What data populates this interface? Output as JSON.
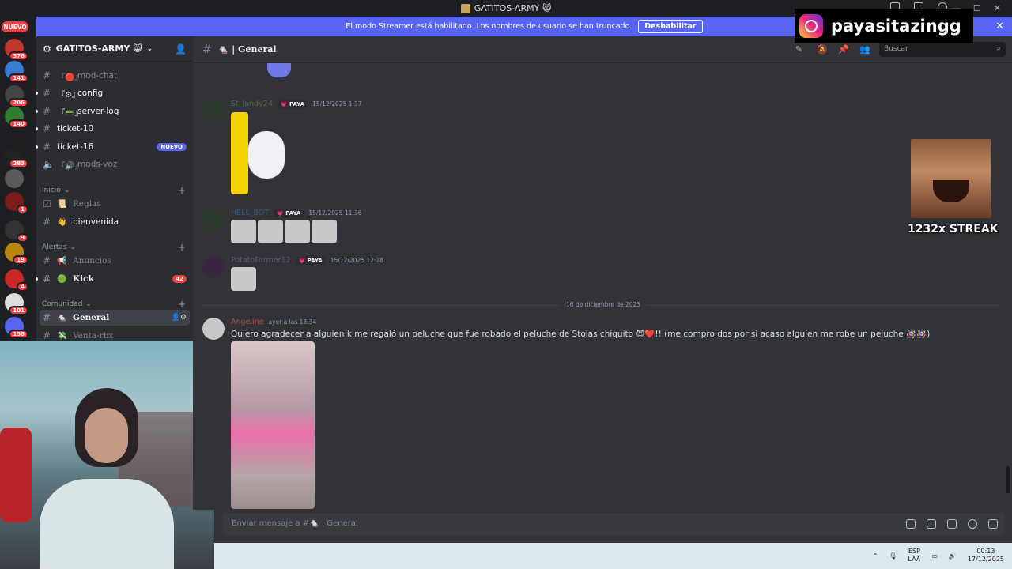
{
  "window": {
    "title": "GATITOS-ARMY 😸"
  },
  "banner": {
    "text": "El modo Streamer está habilitado. Los nombres de usuario se han truncado.",
    "button": "Deshabilitar",
    "close": "✕"
  },
  "rail": {
    "nuevo": "NUEVO",
    "servers": [
      {
        "badge": "376",
        "color": "#c0392b"
      },
      {
        "badge": "141",
        "color": "#3a7bd5"
      },
      {
        "badge": "206",
        "color": "#444"
      },
      {
        "badge": "140",
        "color": "#2e7d32"
      },
      {
        "badge": "283",
        "color": "#222"
      },
      {
        "badge": "",
        "color": "#5a5a5a"
      },
      {
        "badge": "1",
        "color": "#7a1c1c"
      },
      {
        "badge": "9",
        "color": "#333"
      },
      {
        "badge": "19",
        "color": "#b8860b"
      },
      {
        "badge": "4",
        "color": "#c62828"
      },
      {
        "badge": "101",
        "color": "#ddd"
      },
      {
        "badge": "158",
        "color": "#5865f2"
      }
    ]
  },
  "sidebar": {
    "server_name": "GATITOS-ARMY 😸",
    "channels_top": [
      {
        "name": "mod-chat",
        "emoji": "🔴",
        "prefix": "『",
        "muted": true
      },
      {
        "name": "config",
        "emoji": "⚙",
        "prefix": "『",
        "muted": false
      },
      {
        "name": "server-log",
        "emoji": "📟",
        "prefix": "『",
        "muted": false
      },
      {
        "name": "ticket-10",
        "emoji": "",
        "prefix": "",
        "muted": false
      },
      {
        "name": "ticket-16",
        "emoji": "",
        "prefix": "",
        "muted": false,
        "badge": "NUEVO"
      },
      {
        "name": "mods-voz",
        "emoji": "🔊",
        "prefix": "『",
        "muted": true
      }
    ],
    "categories": {
      "inicio": "Inicio",
      "alertas": "Alertas",
      "comunidad": "Comunidad"
    },
    "inicio_channels": [
      {
        "name": "Reglas",
        "emoji": "📜"
      },
      {
        "name": "bienvenida",
        "emoji": "👋"
      }
    ],
    "alertas_channels": [
      {
        "name": "Anuncios",
        "emoji": "📢"
      },
      {
        "name": "Kick",
        "emoji": "🟢",
        "badge": "42"
      }
    ],
    "comunidad_channels": [
      {
        "name": "General",
        "emoji": "🐁"
      },
      {
        "name": "Venta-rbx",
        "emoji": "💸"
      }
    ]
  },
  "header": {
    "channel": "🐁 | General",
    "search_placeholder": "Buscar"
  },
  "messages": [
    {
      "user": "St_Jandy24",
      "tag": "PAYA",
      "time": "15/12/2025 1:37",
      "user_color": "#9ccc65"
    },
    {
      "user": "HELL_BOT",
      "tag": "PAYA",
      "time": "15/12/2025 11:36",
      "user_color": "#42a5f5"
    },
    {
      "user": "PotatoFarmer12",
      "tag": "PAYA",
      "time": "15/12/2025 12:28",
      "user_color": "#ce93d8"
    },
    {
      "user": "Angeline",
      "tag": "",
      "time": "ayer a las 18:34",
      "user_color": "#ef5350",
      "text": "Quiero agradecer a alguien k me regaló un peluche que fue robado el peluche de Stolas chiquito 😈❤️!! (me compro dos por si acaso alguien me robe un peluche 🪅🪅)"
    }
  ],
  "date_divider": "16 de diciembre de 2025",
  "composer": {
    "placeholder": "Enviar mensaje a #🐁 | General"
  },
  "tray": {
    "lang_top": "ESP",
    "lang_bottom": "LAA",
    "time": "00:13",
    "date": "17/12/2025"
  },
  "overlay": {
    "instagram": "payasitazingg",
    "streak": "1232x STREAK"
  }
}
